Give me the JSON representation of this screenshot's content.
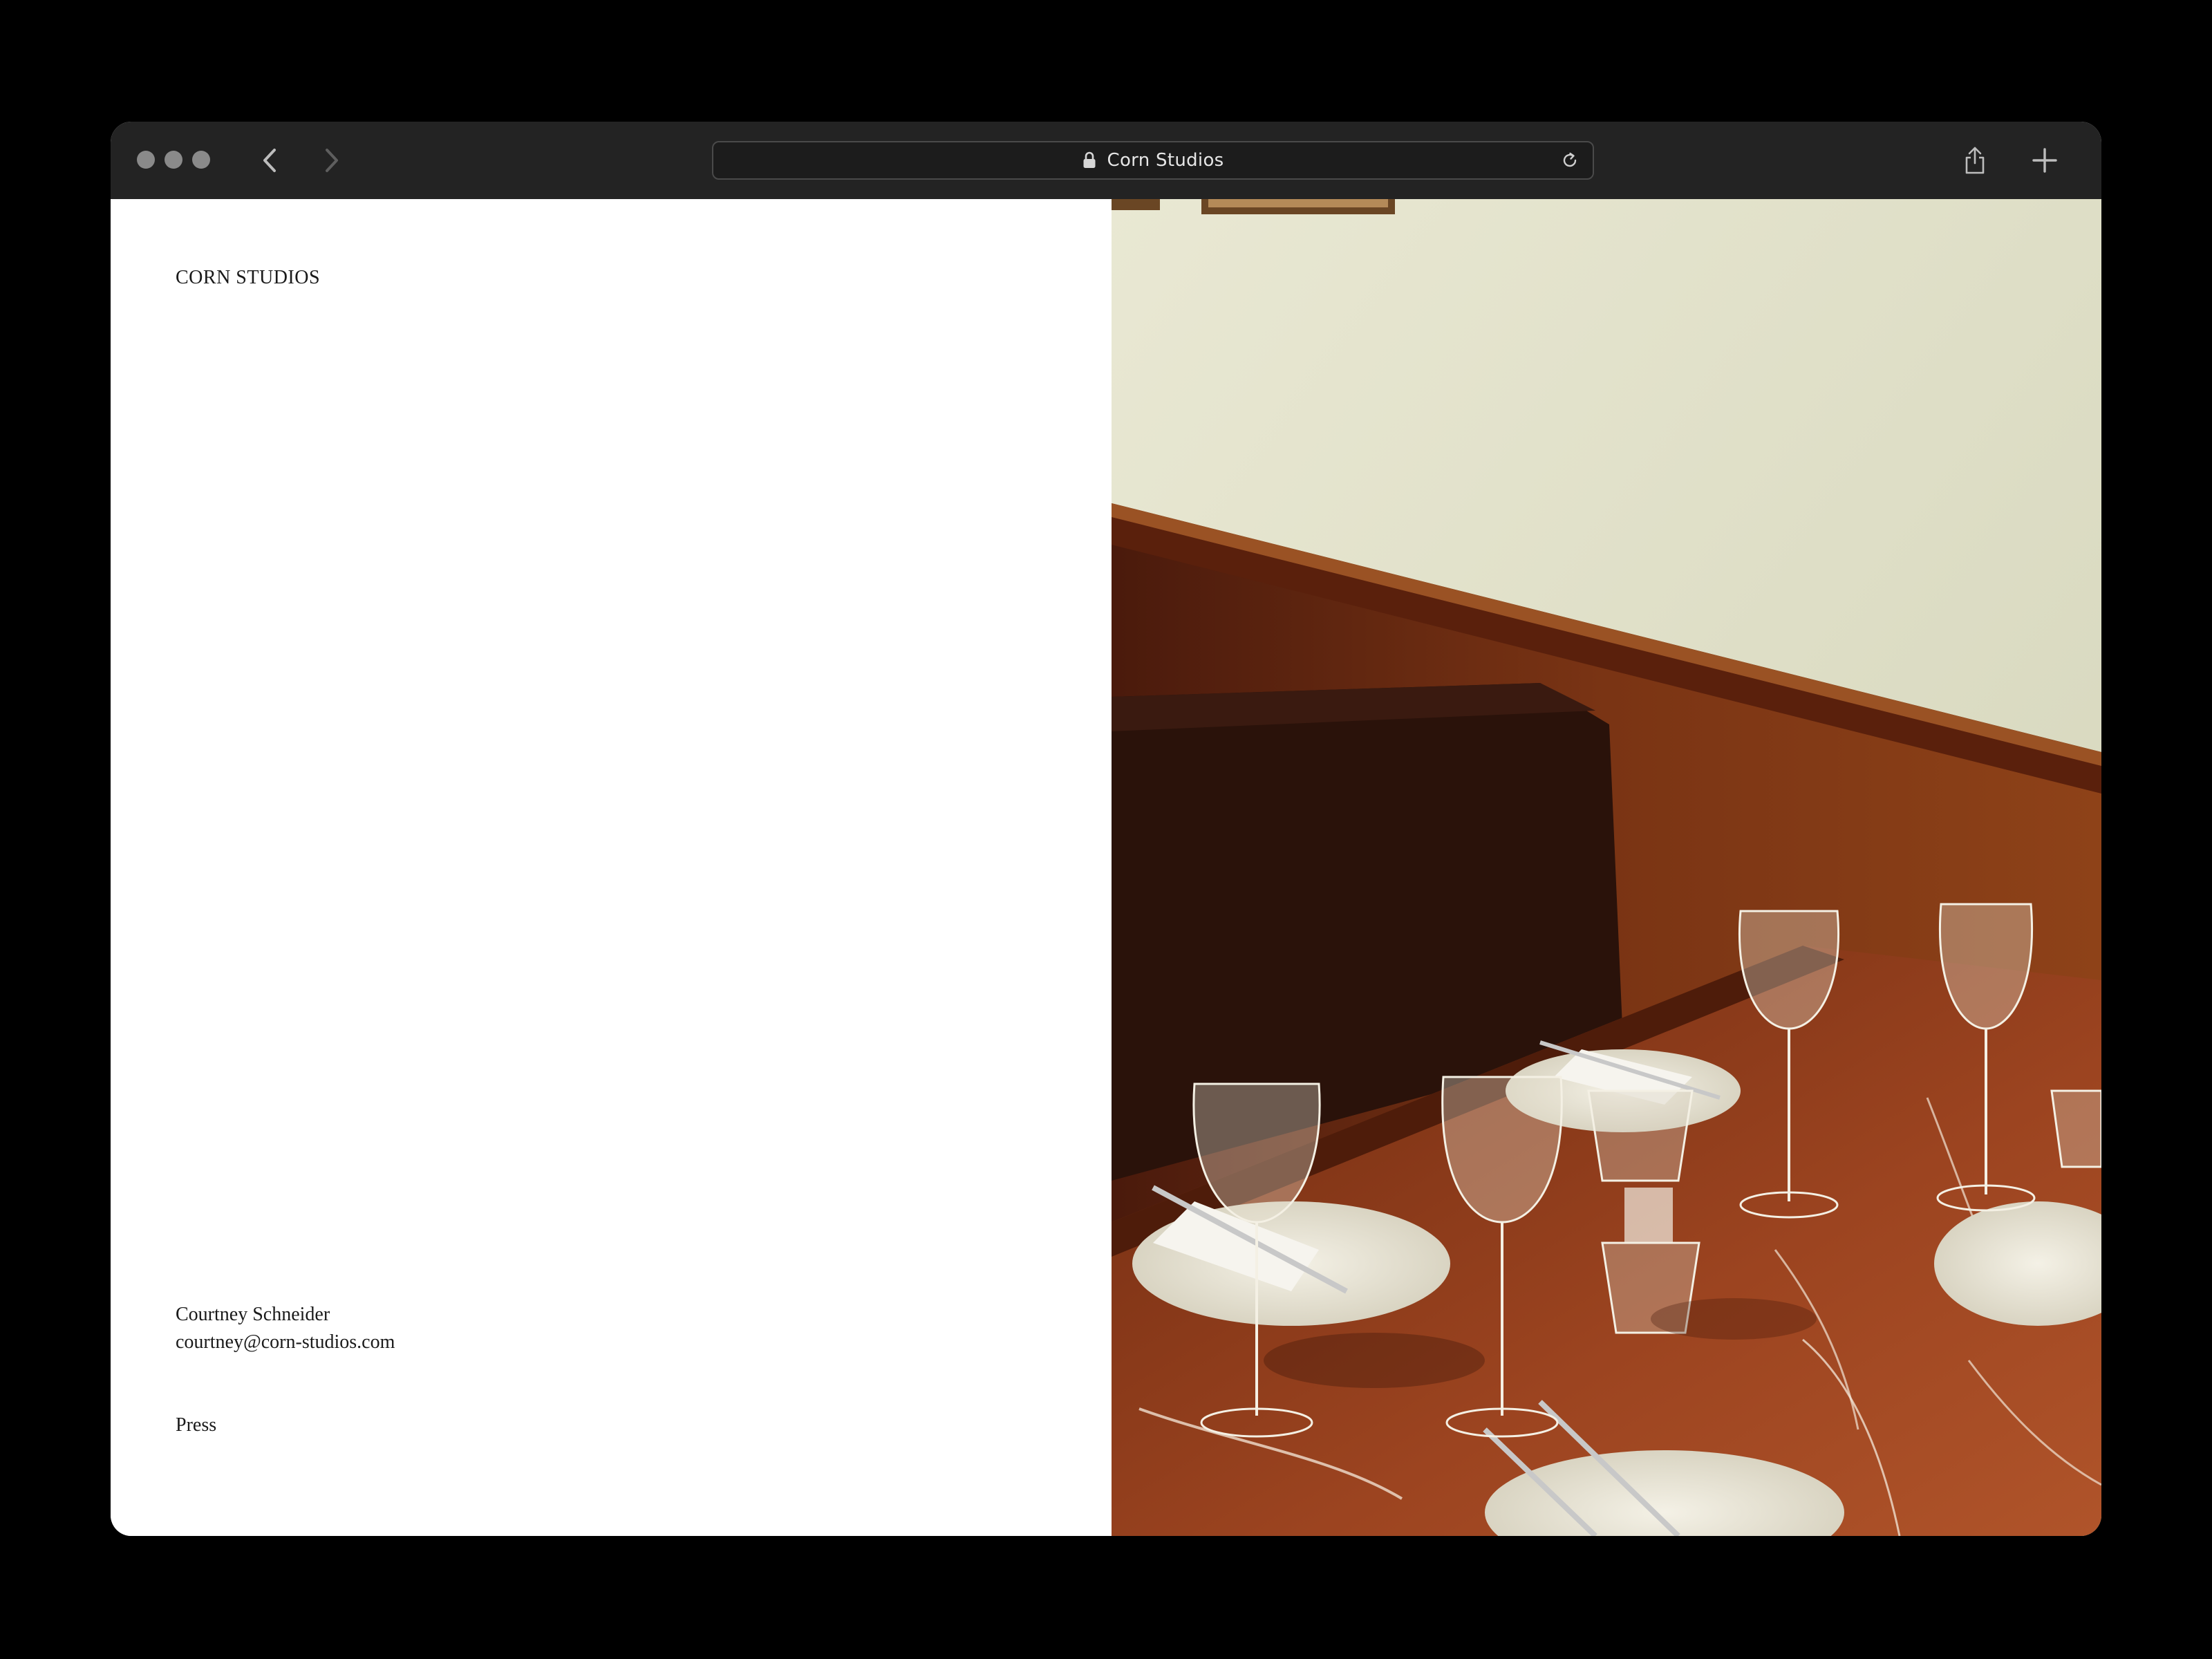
{
  "browser": {
    "url_title": "Corn Studios",
    "icons": {
      "close": "traffic-light-dot",
      "minimize": "traffic-light-dot",
      "zoom": "traffic-light-dot",
      "back": "chevron-left-icon",
      "forward": "chevron-right-icon",
      "lock": "lock-icon",
      "reload": "reload-icon",
      "share": "share-icon",
      "new_tab": "plus-icon"
    }
  },
  "site": {
    "brand": "CORN STUDIOS",
    "contact": {
      "name": "Courtney Schneider",
      "email": "courtney@corn-studios.com"
    },
    "press_link": "Press"
  },
  "colors": {
    "page_background": "#000000",
    "toolbar": "#232323",
    "content_background": "#ffffff",
    "text": "#1a1a1a"
  }
}
